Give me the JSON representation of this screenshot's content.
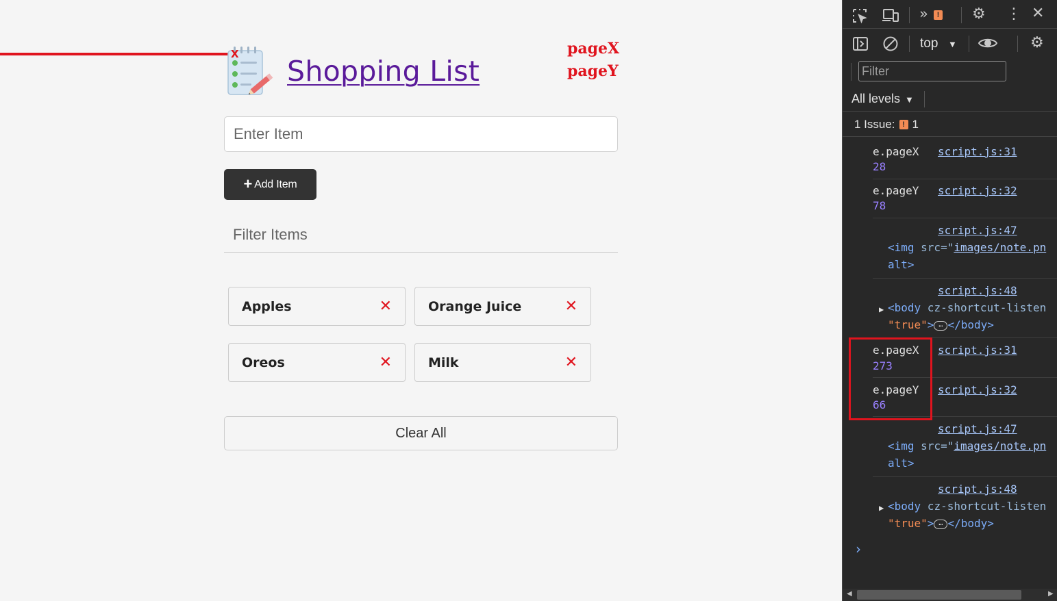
{
  "app": {
    "title": "Shopping List",
    "marker_text": "X",
    "annotations": {
      "pagex": "pageX",
      "pagey": "pageY"
    },
    "input_placeholder": "Enter Item",
    "add_button_label": "Add Item",
    "filter_placeholder": "Filter Items",
    "items": [
      {
        "name": "Apples"
      },
      {
        "name": "Orange Juice"
      },
      {
        "name": "Oreos"
      },
      {
        "name": "Milk"
      }
    ],
    "remove_glyph": "✕",
    "clear_button_label": "Clear All",
    "colors": {
      "accent": "#e0141e",
      "title": "#5a1a9a",
      "button": "#333333"
    }
  },
  "devtools": {
    "context": "top",
    "filter_placeholder": "Filter",
    "levels_label": "All levels",
    "issues_label": "1 Issue:",
    "issues_count": "1",
    "logs": {
      "l0": {
        "label": "e.pageX",
        "value": "28",
        "source": "script.js:31"
      },
      "l1": {
        "label": "e.pageY",
        "value": "78",
        "source": "script.js:32"
      },
      "l2": {
        "source": "script.js:47",
        "tag_open": "<img",
        "attr_name": " src=",
        "quote": "\"",
        "attr_value": "images/note.pn",
        "tail": "alt>"
      },
      "l3": {
        "source": "script.js:48",
        "tag_open": "<body",
        "attr_name": " cz-shortcut-listen",
        "str": "\"true\"",
        "gt": ">",
        "ellipsis": "…",
        "tag_close": "</body>"
      },
      "l4": {
        "label": "e.pageX",
        "value": "273",
        "source": "script.js:31"
      },
      "l5": {
        "label": "e.pageY",
        "value": "66",
        "source": "script.js:32"
      },
      "l6": {
        "source": "script.js:47",
        "tag_open": "<img",
        "attr_name": " src=",
        "quote": "\"",
        "attr_value": "images/note.pn",
        "tail": "alt>"
      },
      "l7": {
        "source": "script.js:48",
        "tag_open": "<body",
        "attr_name": " cz-shortcut-listen",
        "str": "\"true\"",
        "gt": ">",
        "ellipsis": "…",
        "tag_close": "</body>"
      }
    },
    "prompt": "›",
    "colors": {
      "bg": "#282828",
      "number": "#9980ff",
      "link": "#a8c7fa",
      "string": "#f28b54"
    }
  }
}
